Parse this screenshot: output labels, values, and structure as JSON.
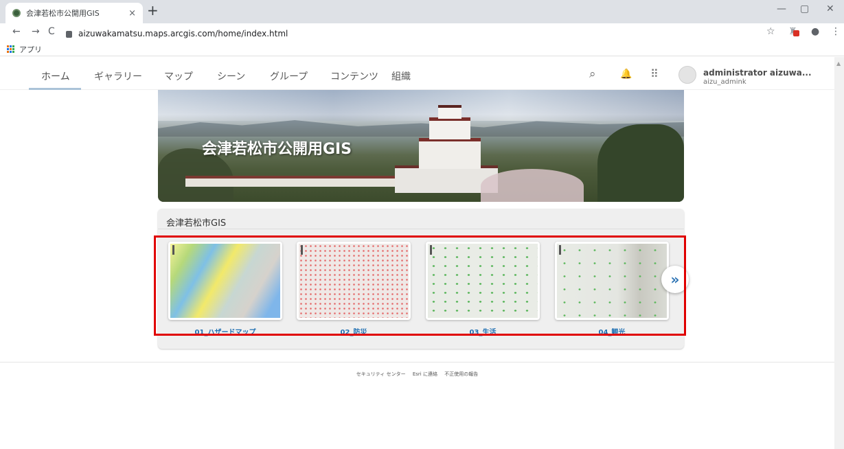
{
  "browser": {
    "tab_title": "会津若松市公開用GIS",
    "tab_close": "×",
    "new_tab": "+",
    "url": "aizuwakamatsu.maps.arcgis.com/home/index.html",
    "bookmarks_apps": "アプリ",
    "window_controls": {
      "minimize": "—",
      "maximize": "▢",
      "close": "✕"
    },
    "nav": {
      "back": "←",
      "forward": "→",
      "reload": "C"
    },
    "toolbar_icons": {
      "star": "☆",
      "profile": "●",
      "menu": "⋮"
    }
  },
  "portal_nav": {
    "items": [
      {
        "label": "ホーム",
        "active": true
      },
      {
        "label": "ギャラリー"
      },
      {
        "label": "マップ"
      },
      {
        "label": "シーン"
      },
      {
        "label": "グループ"
      },
      {
        "label": "コンテンツ"
      },
      {
        "label": "組織"
      }
    ],
    "icons": {
      "search": "⌕",
      "notifications": "🔔",
      "apps": "⠿"
    },
    "user": {
      "name": "administrator aizuwa...",
      "id": "aizu_admink"
    }
  },
  "banner": {
    "title": "会津若松市公開用GIS"
  },
  "gallery": {
    "title": "会津若松市GIS",
    "items": [
      {
        "label": "01_ハザードマップ"
      },
      {
        "label": "02_防災"
      },
      {
        "label": "03_生活"
      },
      {
        "label": "04_観光"
      }
    ],
    "next_label": "»"
  },
  "footer": {
    "links": [
      "セキュリティ センター",
      "Esri に連絡",
      "不正使用の報告"
    ]
  },
  "colors": {
    "highlight": "#e00000",
    "link": "#1f6fb2",
    "nav_underline": "#aac3d8"
  }
}
